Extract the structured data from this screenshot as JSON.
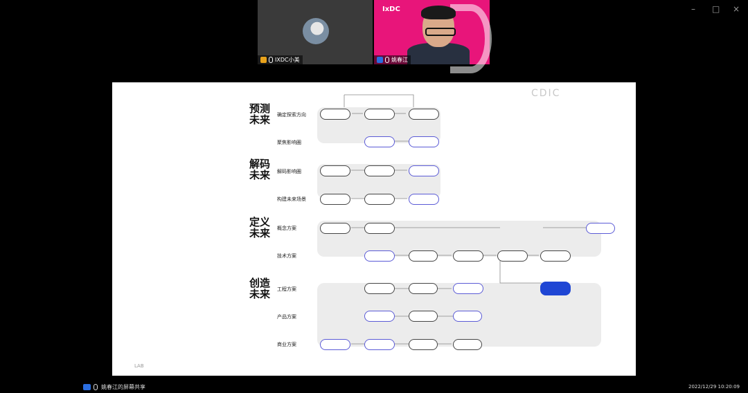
{
  "participants": [
    {
      "name": "IXDC小美",
      "video": "avatar"
    },
    {
      "name": "姚春江",
      "video": "camera",
      "logo": "IxDC"
    }
  ],
  "window_controls": {
    "minimize": "–",
    "maximize": "□",
    "close": "×"
  },
  "slide": {
    "org_logo": "CDIC",
    "sections": [
      "预测\n未来",
      "解码\n未来",
      "定义\n未来",
      "创造\n未来"
    ],
    "row_labels": [
      "确定探索方向",
      "聚焦影响圈",
      "解码影响圈",
      "构建未来场景",
      "概念方案",
      "技术方案",
      "工程方案",
      "产品方案",
      "商业方案"
    ],
    "footer": "LAB"
  },
  "share_bar": {
    "label": "姚春江的屏幕共享",
    "timestamp": "2022/12/29 10:20:09"
  }
}
